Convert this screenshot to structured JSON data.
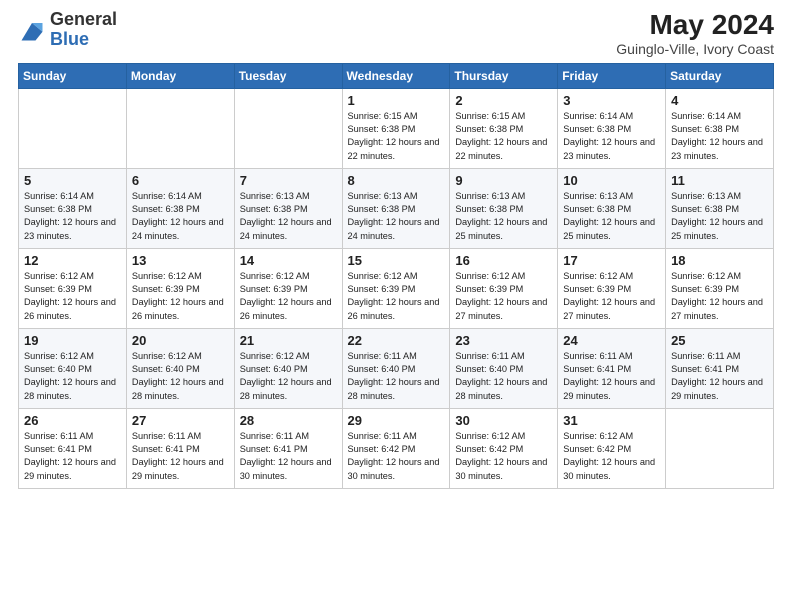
{
  "header": {
    "logo_general": "General",
    "logo_blue": "Blue",
    "main_title": "May 2024",
    "subtitle": "Guinglo-Ville, Ivory Coast"
  },
  "days_of_week": [
    "Sunday",
    "Monday",
    "Tuesday",
    "Wednesday",
    "Thursday",
    "Friday",
    "Saturday"
  ],
  "weeks": [
    [
      {
        "day": "",
        "info": ""
      },
      {
        "day": "",
        "info": ""
      },
      {
        "day": "",
        "info": ""
      },
      {
        "day": "1",
        "info": "Sunrise: 6:15 AM\nSunset: 6:38 PM\nDaylight: 12 hours\nand 22 minutes."
      },
      {
        "day": "2",
        "info": "Sunrise: 6:15 AM\nSunset: 6:38 PM\nDaylight: 12 hours\nand 22 minutes."
      },
      {
        "day": "3",
        "info": "Sunrise: 6:14 AM\nSunset: 6:38 PM\nDaylight: 12 hours\nand 23 minutes."
      },
      {
        "day": "4",
        "info": "Sunrise: 6:14 AM\nSunset: 6:38 PM\nDaylight: 12 hours\nand 23 minutes."
      }
    ],
    [
      {
        "day": "5",
        "info": "Sunrise: 6:14 AM\nSunset: 6:38 PM\nDaylight: 12 hours\nand 23 minutes."
      },
      {
        "day": "6",
        "info": "Sunrise: 6:14 AM\nSunset: 6:38 PM\nDaylight: 12 hours\nand 24 minutes."
      },
      {
        "day": "7",
        "info": "Sunrise: 6:13 AM\nSunset: 6:38 PM\nDaylight: 12 hours\nand 24 minutes."
      },
      {
        "day": "8",
        "info": "Sunrise: 6:13 AM\nSunset: 6:38 PM\nDaylight: 12 hours\nand 24 minutes."
      },
      {
        "day": "9",
        "info": "Sunrise: 6:13 AM\nSunset: 6:38 PM\nDaylight: 12 hours\nand 25 minutes."
      },
      {
        "day": "10",
        "info": "Sunrise: 6:13 AM\nSunset: 6:38 PM\nDaylight: 12 hours\nand 25 minutes."
      },
      {
        "day": "11",
        "info": "Sunrise: 6:13 AM\nSunset: 6:38 PM\nDaylight: 12 hours\nand 25 minutes."
      }
    ],
    [
      {
        "day": "12",
        "info": "Sunrise: 6:12 AM\nSunset: 6:39 PM\nDaylight: 12 hours\nand 26 minutes."
      },
      {
        "day": "13",
        "info": "Sunrise: 6:12 AM\nSunset: 6:39 PM\nDaylight: 12 hours\nand 26 minutes."
      },
      {
        "day": "14",
        "info": "Sunrise: 6:12 AM\nSunset: 6:39 PM\nDaylight: 12 hours\nand 26 minutes."
      },
      {
        "day": "15",
        "info": "Sunrise: 6:12 AM\nSunset: 6:39 PM\nDaylight: 12 hours\nand 26 minutes."
      },
      {
        "day": "16",
        "info": "Sunrise: 6:12 AM\nSunset: 6:39 PM\nDaylight: 12 hours\nand 27 minutes."
      },
      {
        "day": "17",
        "info": "Sunrise: 6:12 AM\nSunset: 6:39 PM\nDaylight: 12 hours\nand 27 minutes."
      },
      {
        "day": "18",
        "info": "Sunrise: 6:12 AM\nSunset: 6:39 PM\nDaylight: 12 hours\nand 27 minutes."
      }
    ],
    [
      {
        "day": "19",
        "info": "Sunrise: 6:12 AM\nSunset: 6:40 PM\nDaylight: 12 hours\nand 28 minutes."
      },
      {
        "day": "20",
        "info": "Sunrise: 6:12 AM\nSunset: 6:40 PM\nDaylight: 12 hours\nand 28 minutes."
      },
      {
        "day": "21",
        "info": "Sunrise: 6:12 AM\nSunset: 6:40 PM\nDaylight: 12 hours\nand 28 minutes."
      },
      {
        "day": "22",
        "info": "Sunrise: 6:11 AM\nSunset: 6:40 PM\nDaylight: 12 hours\nand 28 minutes."
      },
      {
        "day": "23",
        "info": "Sunrise: 6:11 AM\nSunset: 6:40 PM\nDaylight: 12 hours\nand 28 minutes."
      },
      {
        "day": "24",
        "info": "Sunrise: 6:11 AM\nSunset: 6:41 PM\nDaylight: 12 hours\nand 29 minutes."
      },
      {
        "day": "25",
        "info": "Sunrise: 6:11 AM\nSunset: 6:41 PM\nDaylight: 12 hours\nand 29 minutes."
      }
    ],
    [
      {
        "day": "26",
        "info": "Sunrise: 6:11 AM\nSunset: 6:41 PM\nDaylight: 12 hours\nand 29 minutes."
      },
      {
        "day": "27",
        "info": "Sunrise: 6:11 AM\nSunset: 6:41 PM\nDaylight: 12 hours\nand 29 minutes."
      },
      {
        "day": "28",
        "info": "Sunrise: 6:11 AM\nSunset: 6:41 PM\nDaylight: 12 hours\nand 30 minutes."
      },
      {
        "day": "29",
        "info": "Sunrise: 6:11 AM\nSunset: 6:42 PM\nDaylight: 12 hours\nand 30 minutes."
      },
      {
        "day": "30",
        "info": "Sunrise: 6:12 AM\nSunset: 6:42 PM\nDaylight: 12 hours\nand 30 minutes."
      },
      {
        "day": "31",
        "info": "Sunrise: 6:12 AM\nSunset: 6:42 PM\nDaylight: 12 hours\nand 30 minutes."
      },
      {
        "day": "",
        "info": ""
      }
    ]
  ]
}
